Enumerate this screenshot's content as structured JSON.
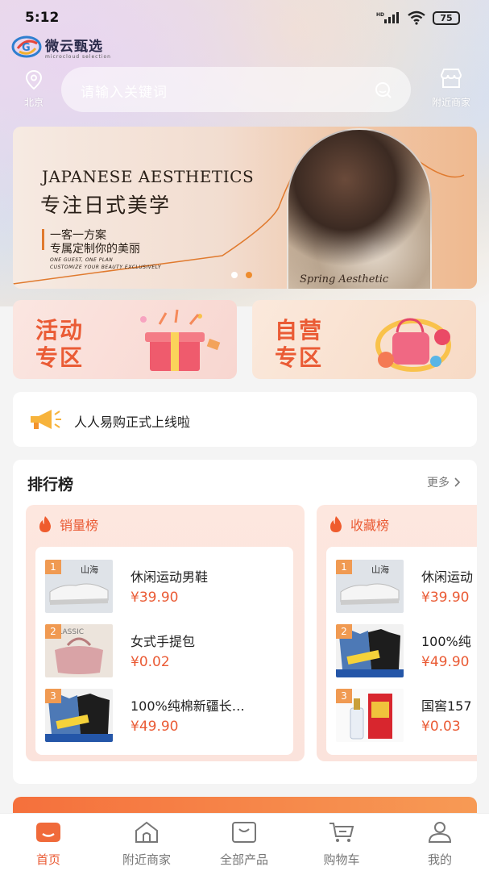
{
  "status_bar": {
    "time": "5:12",
    "battery": "75"
  },
  "app": {
    "name": "微云甄选",
    "sub": "microcloud selection"
  },
  "header": {
    "location": "北京",
    "search_placeholder": "请输入关键词",
    "nearby_label": "附近商家"
  },
  "banner": {
    "title_en": "JAPANESE AESTHETICS",
    "title_cn": "专注日式美学",
    "line1": "一客一方案",
    "line2": "专属定制你的美丽",
    "en_line1": "ONE GUEST, ONE PLAN",
    "en_line2": "CUSTOMIZE YOUR BEAUTY EXCLUSIVELY",
    "script": "Spring Aesthetic",
    "active_slide": 2,
    "slide_count": 2
  },
  "promos": [
    {
      "line1": "活动",
      "line2": "专区"
    },
    {
      "line1": "自营",
      "line2": "专区"
    }
  ],
  "notice": {
    "text": "人人易购正式上线啦"
  },
  "ranking": {
    "title": "排行榜",
    "more": "更多",
    "boards": [
      {
        "name": "销量榜",
        "items": [
          {
            "rank": "1",
            "name": "休闲运动男鞋",
            "price": "¥39.90"
          },
          {
            "rank": "2",
            "name": "女式手提包",
            "price": "¥0.02"
          },
          {
            "rank": "3",
            "name": "100%纯棉新疆长…",
            "price": "¥49.90"
          }
        ]
      },
      {
        "name": "收藏榜",
        "items": [
          {
            "rank": "1",
            "name": "休闲运动",
            "price": "¥39.90"
          },
          {
            "rank": "2",
            "name": "100%纯",
            "price": "¥49.90"
          },
          {
            "rank": "3",
            "name": "国窖157",
            "price": "¥0.03"
          }
        ]
      }
    ]
  },
  "tabbar": [
    {
      "label": "首页",
      "icon": "home-icon"
    },
    {
      "label": "附近商家",
      "icon": "house-icon"
    },
    {
      "label": "全部产品",
      "icon": "bag-icon"
    },
    {
      "label": "购物车",
      "icon": "cart-icon"
    },
    {
      "label": "我的",
      "icon": "user-icon"
    }
  ],
  "colors": {
    "accent": "#ea5b35",
    "rank_badge": "#f09a52"
  }
}
